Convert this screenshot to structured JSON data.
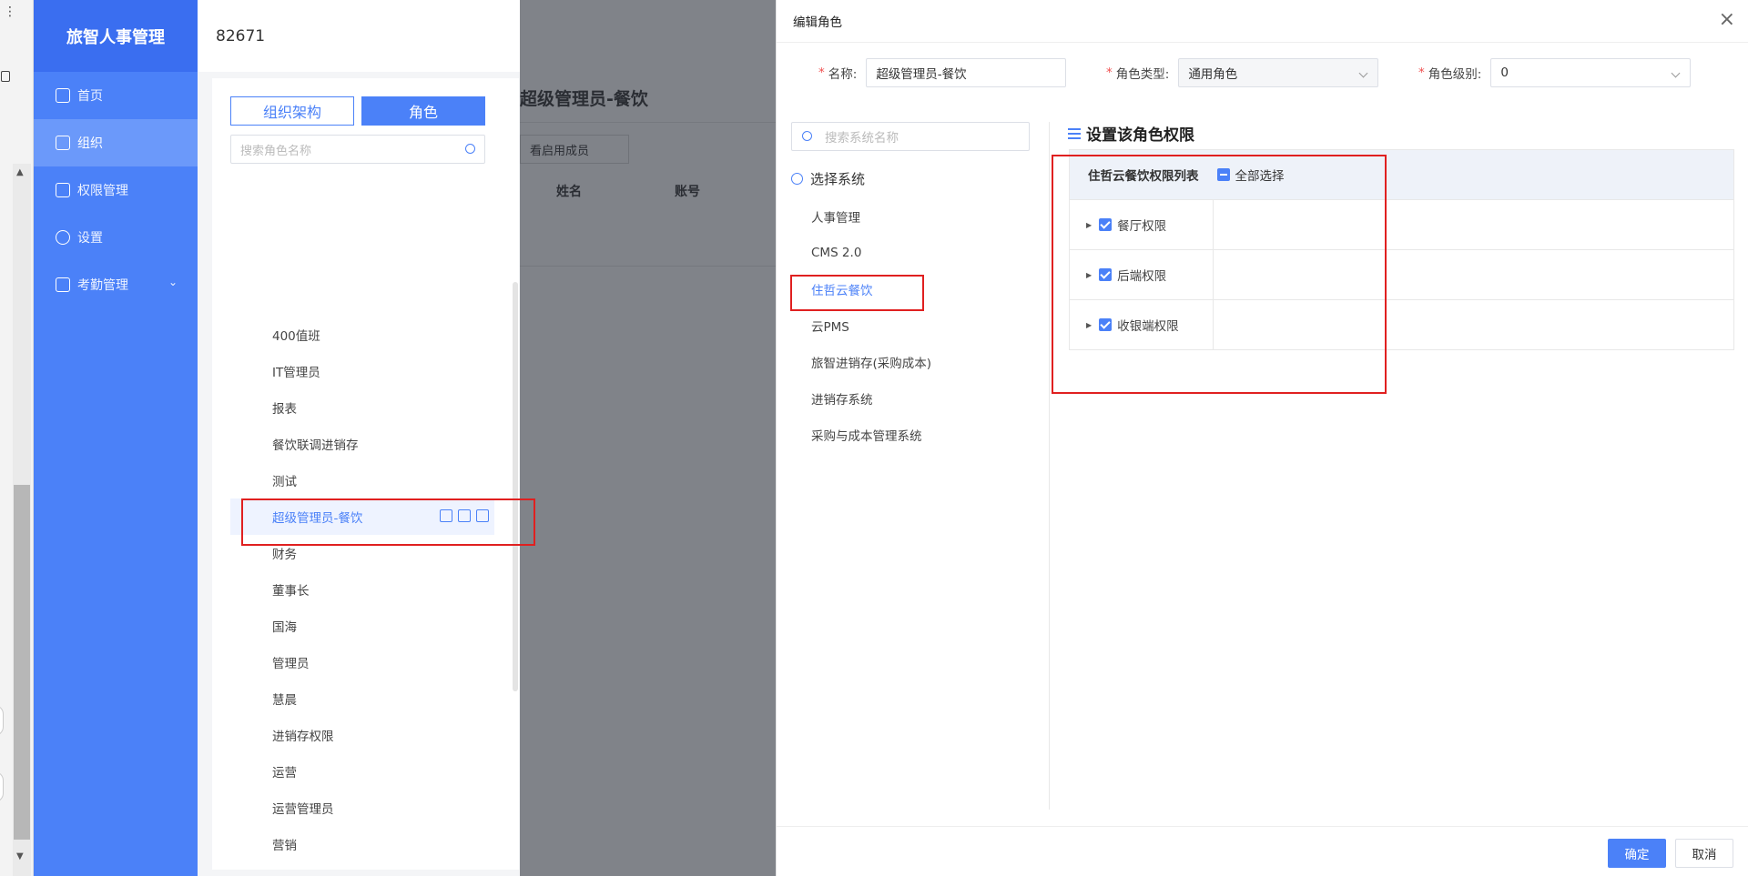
{
  "app": {
    "brand": "旅智人事管理",
    "top_id": "82671"
  },
  "sidebar": {
    "items": [
      {
        "label": "首页",
        "icon": "chart-icon"
      },
      {
        "label": "组织",
        "icon": "org-icon"
      },
      {
        "label": "权限管理",
        "icon": "sliders-icon"
      },
      {
        "label": "设置",
        "icon": "gear-icon"
      },
      {
        "label": "考勤管理",
        "icon": "printer-icon"
      }
    ]
  },
  "role_panel": {
    "tab_org": "组织架构",
    "tab_role": "角色",
    "search_placeholder": "搜索角色名称",
    "roles": [
      "400值班",
      "IT管理员",
      "报表",
      "餐饮联调进销存",
      "测试",
      "超级管理员-餐饮",
      "财务",
      "董事长",
      "国海",
      "管理员",
      "慧晨",
      "进销存权限",
      "运营",
      "运营管理员",
      "营销"
    ],
    "selected": "超级管理员-餐饮"
  },
  "background_page": {
    "title": "超级管理员-餐饮",
    "filter": "看启用成员",
    "col_name": "姓名",
    "col_account": "账号"
  },
  "drawer": {
    "title": "编辑角色",
    "name_label": "名称:",
    "name_value": "超级管理员-餐饮",
    "type_label": "角色类型:",
    "type_value": "通用角色",
    "level_label": "角色级别:",
    "level_value": "0",
    "system_search_placeholder": "搜索系统名称",
    "system_title": "选择系统",
    "systems": [
      "人事管理",
      "CMS 2.0",
      "住哲云餐饮",
      "云PMS",
      "旅智进销存(采购成本)",
      "进销存系统",
      "采购与成本管理系统"
    ],
    "selected_system": "住哲云餐饮",
    "perm_title": "设置该角色权限",
    "perm_list_title": "住哲云餐饮权限列表",
    "select_all": "全部选择",
    "permissions": [
      "餐厅权限",
      "后端权限",
      "收银端权限"
    ],
    "ok": "确定",
    "cancel": "取消"
  },
  "colors": {
    "primary": "#4b81f8",
    "highlight": "#e02020",
    "overlay": "#808389"
  }
}
